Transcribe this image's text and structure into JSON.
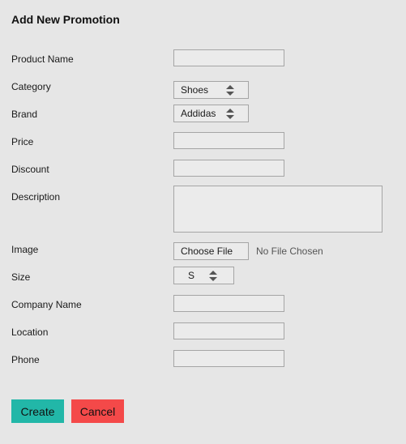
{
  "form": {
    "title": "Add New Promotion",
    "fields": {
      "product_name": {
        "label": "Product Name",
        "value": ""
      },
      "category": {
        "label": "Category",
        "value": "Shoes"
      },
      "brand": {
        "label": "Brand",
        "value": "Addidas"
      },
      "price": {
        "label": "Price",
        "value": ""
      },
      "discount": {
        "label": "Discount",
        "value": ""
      },
      "description": {
        "label": "Description",
        "value": ""
      },
      "image": {
        "label": "Image",
        "button_label": "Choose File",
        "status": "No File Chosen"
      },
      "size": {
        "label": "Size",
        "value": "S"
      },
      "company_name": {
        "label": "Company Name",
        "value": ""
      },
      "location": {
        "label": "Location",
        "value": ""
      },
      "phone": {
        "label": "Phone",
        "value": ""
      }
    },
    "buttons": {
      "create_label": "Create",
      "cancel_label": "Cancel"
    },
    "icons": {
      "select_arrow": "up-down-arrows-icon"
    },
    "colors": {
      "create_button": "#22b7a8",
      "cancel_button": "#f44949",
      "background": "#e6e6e6"
    }
  }
}
